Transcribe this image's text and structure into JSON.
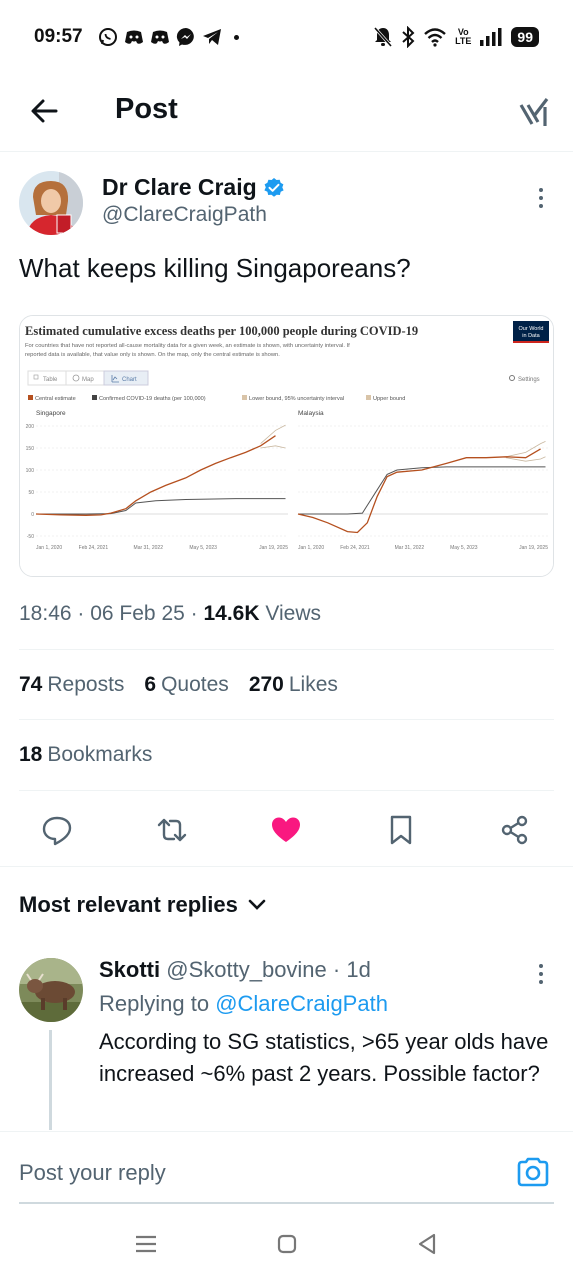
{
  "status_bar": {
    "time": "09:57",
    "volte_top": "Vo",
    "volte_bottom": "LTE",
    "battery": "99"
  },
  "header": {
    "title": "Post"
  },
  "post": {
    "author_name": "Dr Clare Craig",
    "author_handle": "@ClareCraigPath",
    "text": "What keeps killing Singaporeans?",
    "time": "18:46",
    "date": "06 Feb 25",
    "views_count": "14.6K",
    "views_label": "Views",
    "reposts_count": "74",
    "reposts_label": "Reposts",
    "quotes_count": "6",
    "quotes_label": "Quotes",
    "likes_count": "270",
    "likes_label": "Likes",
    "bookmarks_count": "18",
    "bookmarks_label": "Bookmarks",
    "liked": true,
    "like_color": "#f91880"
  },
  "chart_data": {
    "type": "line",
    "title": "Estimated cumulative excess deaths per 100,000 people during COVID-19",
    "subtitle_line1": "For countries that have not reported all-cause mortality data for a given week, an estimate is shown, with uncertainty interval. If",
    "subtitle_line2": "reported data is available, that value only is shown. On the map, only the central estimate is shown.",
    "logo_line1": "Our World",
    "logo_line2": "in Data",
    "tabs": [
      "Table",
      "Map",
      "Chart"
    ],
    "active_tab": "Chart",
    "settings_label": "Settings",
    "legend": [
      {
        "label": "Central estimate",
        "color": "#b5501f"
      },
      {
        "label": "Confirmed COVID-19 deaths (per 100,000)",
        "color": "#444444"
      },
      {
        "label": "Lower bound, 95% uncertainty interval",
        "color": "#d9c4a8"
      },
      {
        "label": "Upper bound",
        "color": "#d9c4a8"
      }
    ],
    "ylim": [
      -50,
      200
    ],
    "yticks": [
      "200",
      "150",
      "100",
      "50",
      "0",
      "-50"
    ],
    "xticks": [
      "Jan 1, 2020",
      "Feb 24, 2021",
      "Mar 31, 2022",
      "May 5, 2023",
      "Jan 19, 2025"
    ],
    "panels": [
      {
        "name": "Singapore",
        "central_estimate": {
          "x": [
            2020.0,
            2020.5,
            2021.0,
            2021.3,
            2021.5,
            2021.8,
            2022.0,
            2022.3,
            2022.6,
            2023.0,
            2023.3,
            2023.6,
            2023.9,
            2024.2,
            2024.5,
            2024.8
          ],
          "y": [
            0,
            -2,
            -3,
            -2,
            2,
            12,
            30,
            50,
            65,
            82,
            100,
            115,
            128,
            140,
            155,
            178
          ]
        },
        "confirmed_covid": {
          "x": [
            2020.0,
            2021.0,
            2021.5,
            2021.8,
            2022.0,
            2022.4,
            2023.0,
            2024.0,
            2025.0
          ],
          "y": [
            0,
            0,
            1,
            8,
            25,
            30,
            33,
            35,
            35
          ]
        },
        "upper_bound_tail": {
          "x": [
            2024.5,
            2024.8,
            2025.0
          ],
          "y": [
            160,
            190,
            202
          ]
        },
        "lower_bound_tail": {
          "x": [
            2024.5,
            2024.8,
            2025.0
          ],
          "y": [
            150,
            155,
            150
          ]
        }
      },
      {
        "name": "Malaysia",
        "central_estimate": {
          "x": [
            2020.0,
            2020.3,
            2020.6,
            2021.0,
            2021.2,
            2021.4,
            2021.6,
            2021.8,
            2022.0,
            2022.5,
            2023.0,
            2023.4,
            2023.8,
            2024.2,
            2024.6,
            2024.9
          ],
          "y": [
            0,
            -8,
            -20,
            -40,
            -42,
            -20,
            40,
            85,
            95,
            100,
            115,
            128,
            128,
            130,
            128,
            148
          ]
        },
        "confirmed_covid": {
          "x": [
            2020.0,
            2021.0,
            2021.3,
            2021.6,
            2021.8,
            2022.0,
            2022.5,
            2023.0,
            2025.0
          ],
          "y": [
            0,
            0,
            2,
            55,
            90,
            100,
            105,
            107,
            107
          ]
        },
        "upper_bound_tail": {
          "x": [
            2024.2,
            2024.6,
            2024.9,
            2025.0
          ],
          "y": [
            130,
            140,
            160,
            165
          ]
        },
        "lower_bound_tail": {
          "x": [
            2024.2,
            2024.6,
            2024.9,
            2025.0
          ],
          "y": [
            128,
            120,
            125,
            130
          ]
        }
      }
    ]
  },
  "replies_section": {
    "title": "Most relevant replies"
  },
  "reply": {
    "name": "Skotti",
    "handle": "@Skotty_bovine",
    "dot": "·",
    "time": "1d",
    "replying_label": "Replying to",
    "replying_to": "@ClareCraigPath",
    "text": "According to SG statistics, >65 year olds have increased ~6% past 2 years. Possible factor?"
  },
  "composer": {
    "placeholder": "Post your reply"
  }
}
